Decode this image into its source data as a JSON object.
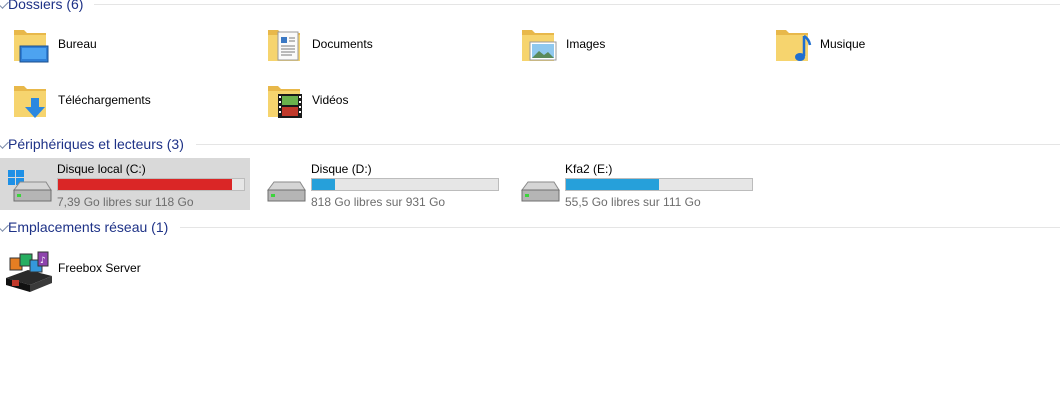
{
  "groups": {
    "folders": {
      "title": "Dossiers (6)",
      "items": [
        {
          "label": "Bureau",
          "icon": "desktop-folder-icon"
        },
        {
          "label": "Documents",
          "icon": "documents-folder-icon"
        },
        {
          "label": "Images",
          "icon": "pictures-folder-icon"
        },
        {
          "label": "Musique",
          "icon": "music-folder-icon"
        },
        {
          "label": "Téléchargements",
          "icon": "downloads-folder-icon"
        },
        {
          "label": "Vidéos",
          "icon": "videos-folder-icon"
        }
      ]
    },
    "devices": {
      "title": "Périphériques et lecteurs (3)",
      "items": [
        {
          "label": "Disque local (C:)",
          "free_text": "7,39 Go libres sur 118 Go",
          "used_fraction": 0.937,
          "bar_color": "#da2626",
          "icon": "windows-drive-icon",
          "selected": true
        },
        {
          "label": "Disque (D:)",
          "free_text": "818 Go libres sur 931 Go",
          "used_fraction": 0.121,
          "bar_color": "#26a0da",
          "icon": "hard-drive-icon",
          "selected": false
        },
        {
          "label": "Kfa2 (E:)",
          "free_text": "55,5 Go libres sur 111 Go",
          "used_fraction": 0.5,
          "bar_color": "#26a0da",
          "icon": "hard-drive-icon",
          "selected": false
        }
      ]
    },
    "network": {
      "title": "Emplacements réseau (1)",
      "items": [
        {
          "label": "Freebox Server",
          "icon": "media-server-icon"
        }
      ]
    }
  }
}
